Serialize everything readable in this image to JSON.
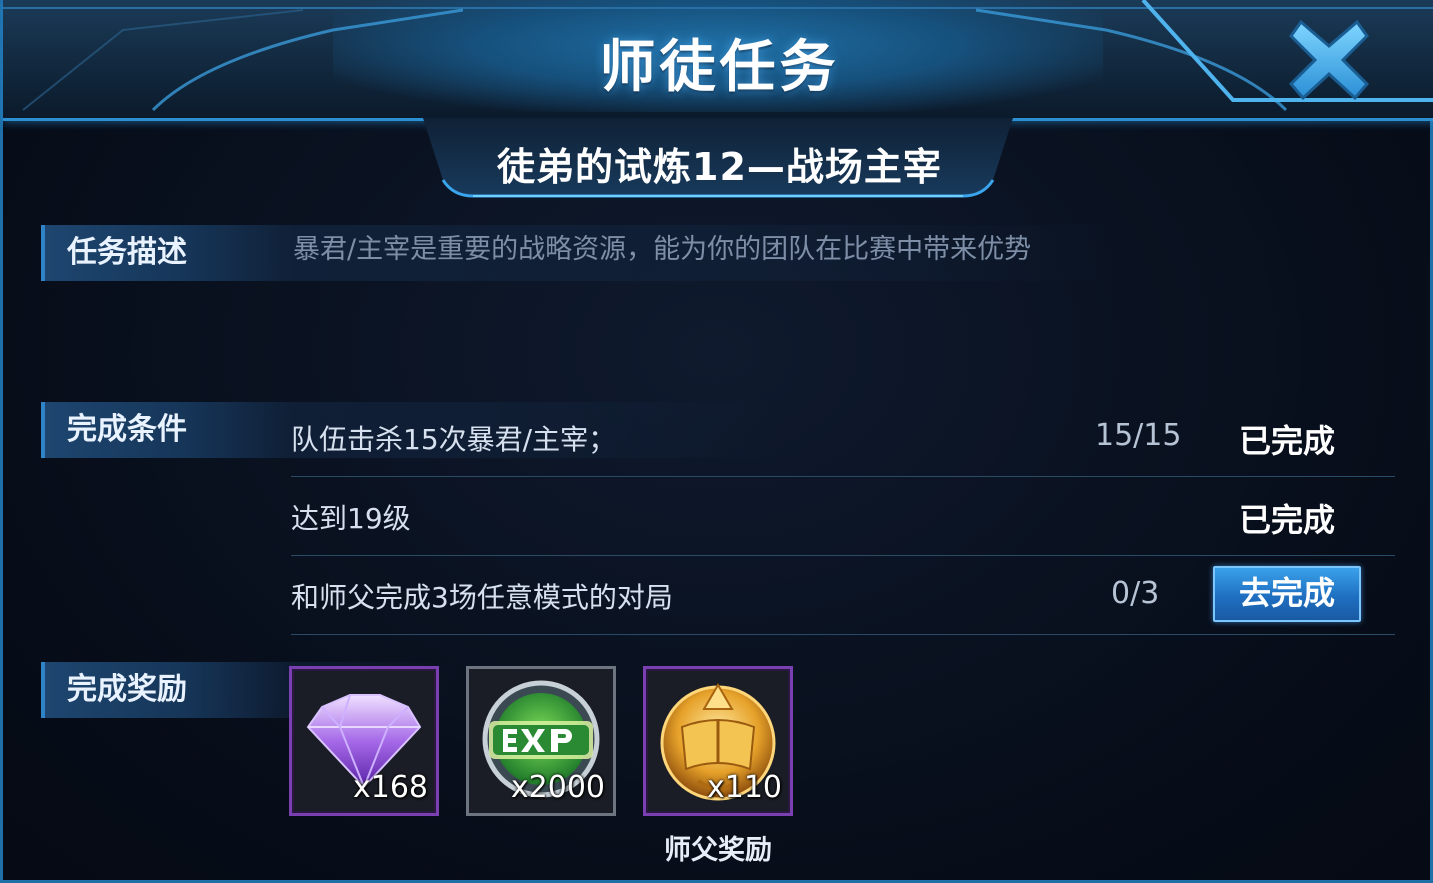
{
  "header": {
    "title": "师徒任务",
    "close_icon": "close-x-icon"
  },
  "task": {
    "name": "徒弟的试炼12—战场主宰"
  },
  "description": {
    "label": "任务描述",
    "text": "暴君/主宰是重要的战略资源，能为你的团队在比赛中带来优势"
  },
  "conditions": {
    "label": "完成条件",
    "items": [
      {
        "text": "队伍击杀15次暴君/主宰；",
        "progress": "15/15",
        "status": "已完成"
      },
      {
        "text": "达到19级",
        "progress": "",
        "status": "已完成"
      },
      {
        "text": "和师父完成3场任意模式的对局",
        "progress": "0/3",
        "button": "去完成"
      }
    ]
  },
  "rewards": {
    "label": "完成奖励",
    "items": [
      {
        "icon": "purple-diamond-icon",
        "qty": "x168"
      },
      {
        "icon": "exp-icon",
        "qty": "x2000"
      },
      {
        "icon": "master-medal-icon",
        "qty": "x110",
        "caption": "师父奖励"
      }
    ]
  },
  "colors": {
    "accent": "#2c8fd0",
    "button": "#1f6fc1",
    "panel": "#0a1222"
  }
}
